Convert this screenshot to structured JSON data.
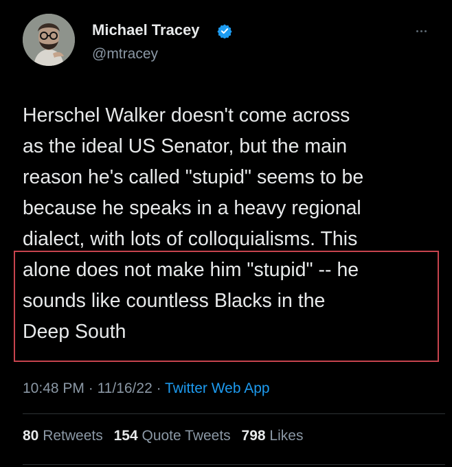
{
  "author": {
    "name": "Michael Tracey",
    "handle": "@mtracey"
  },
  "tweet": {
    "lines": [
      "Herschel Walker doesn't come across",
      "as the ideal US Senator, but the main",
      "reason he's called \"stupid\" seems to be",
      "because he speaks in a heavy regional",
      "dialect, with lots of colloquialisms. This",
      "alone does not make him \"stupid\" -- he",
      "sounds like countless Blacks in the",
      "Deep South"
    ]
  },
  "meta": {
    "time": "10:48 PM",
    "sep1": " · ",
    "date": "11/16/22",
    "sep2": " · ",
    "source": "Twitter Web App"
  },
  "stats": {
    "retweets_count": "80",
    "retweets_label": "Retweets",
    "quotes_count": "154",
    "quotes_label": "Quote Tweets",
    "likes_count": "798",
    "likes_label": "Likes"
  },
  "icons": {
    "verified": "verified-badge-icon",
    "more": "more-options-icon"
  },
  "colors": {
    "background": "#000000",
    "text": "#e7e9ea",
    "secondary": "#8b98a5",
    "link": "#1d9bf0",
    "highlight": "#c8444e"
  }
}
